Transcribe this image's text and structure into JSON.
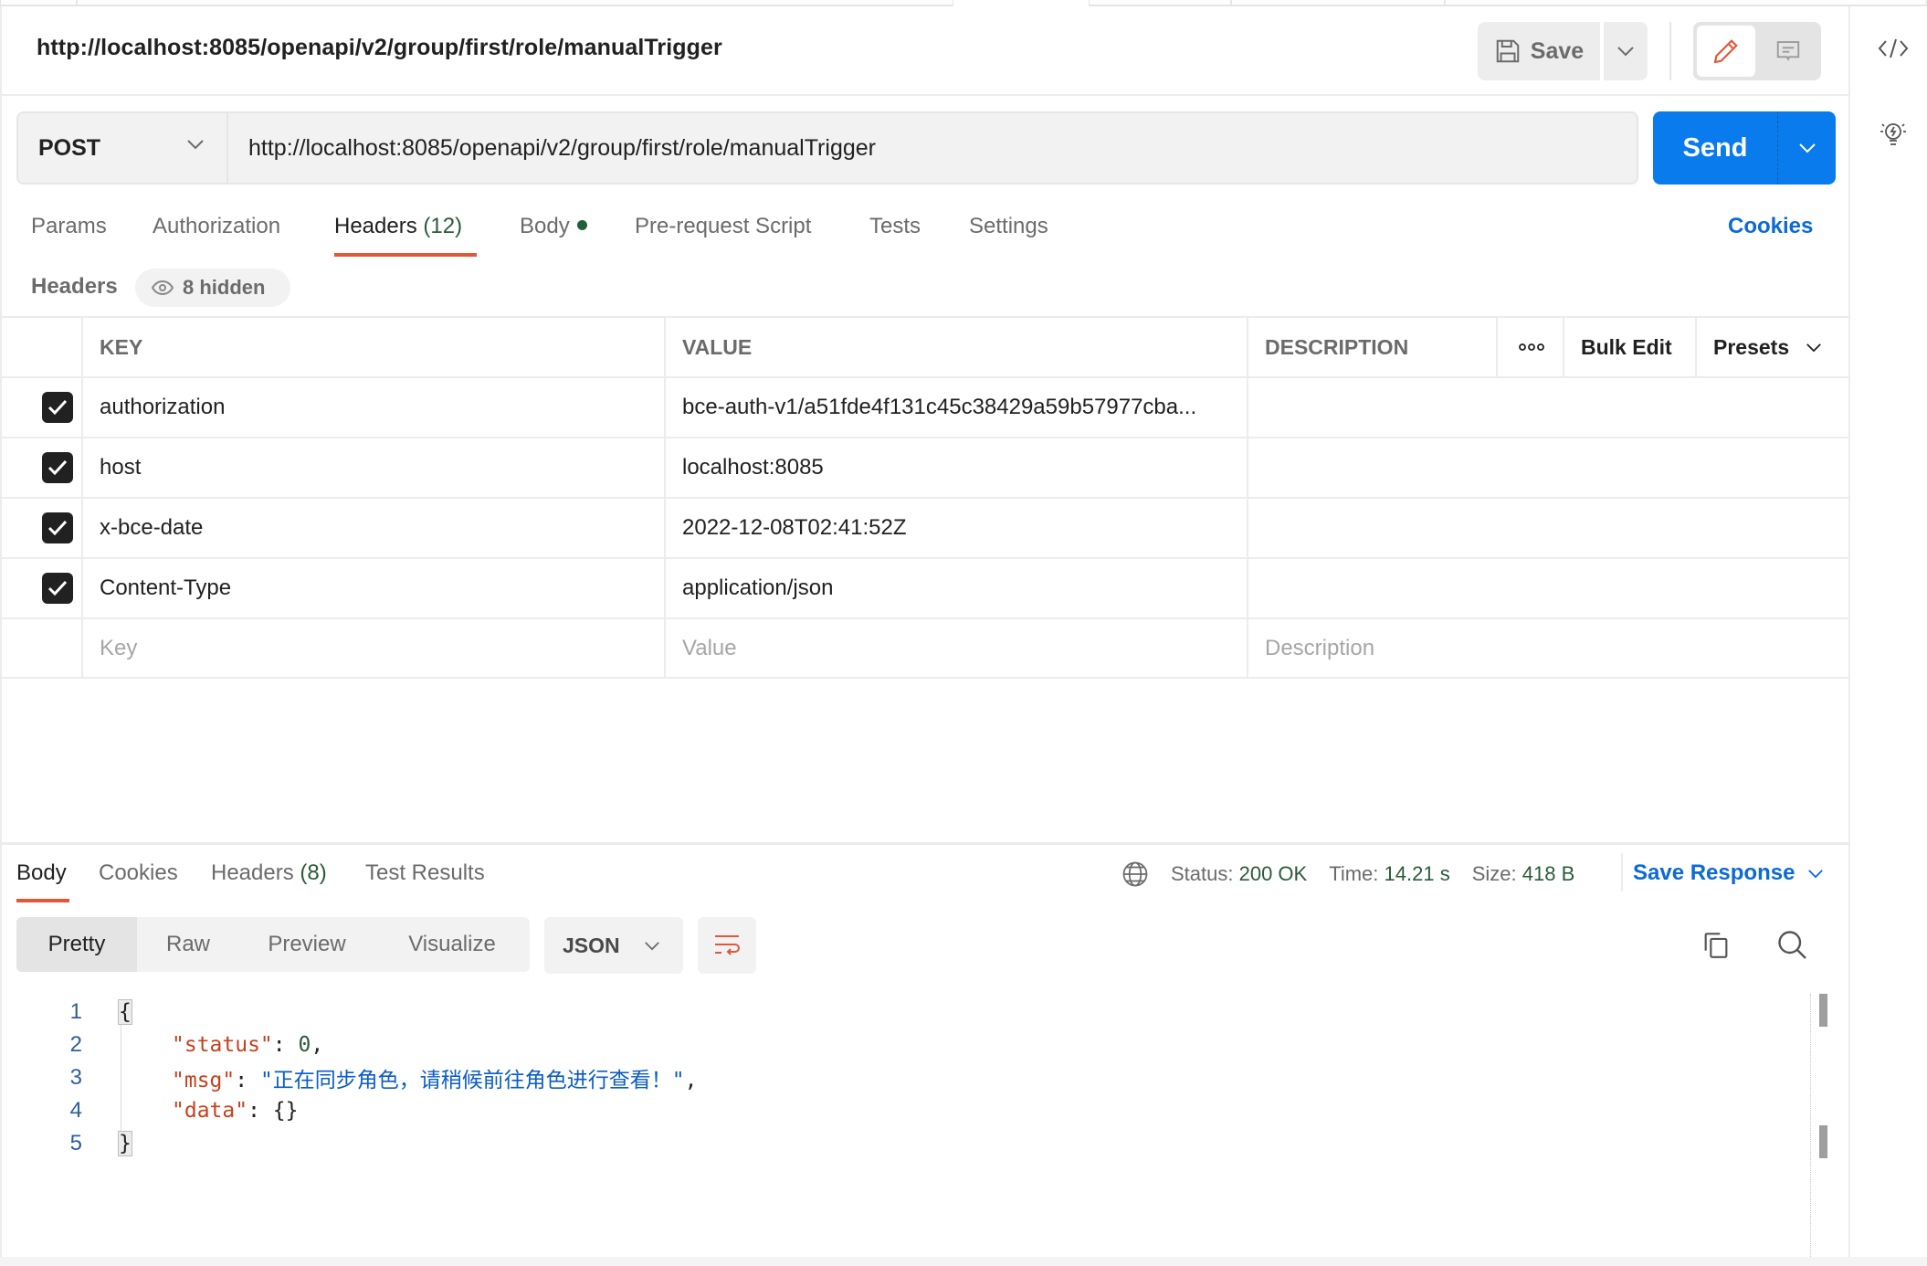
{
  "request": {
    "title": "http://localhost:8085/openapi/v2/group/first/role/manualTrigger",
    "method": "POST",
    "url": "http://localhost:8085/openapi/v2/group/first/role/manualTrigger"
  },
  "toolbar": {
    "save_label": "Save",
    "send_label": "Send",
    "save_icon": "floppy-disk-icon",
    "edit_icon": "pencil-icon",
    "comment_icon": "comment-icon"
  },
  "right_sidebar": {
    "items": [
      {
        "icon": "code-icon"
      },
      {
        "icon": "lightbulb-icon"
      }
    ]
  },
  "request_tabs": {
    "items": [
      {
        "label": "Params"
      },
      {
        "label": "Authorization"
      },
      {
        "label": "Headers",
        "count": "(12)",
        "active": true
      },
      {
        "label": "Body",
        "dot": true
      },
      {
        "label": "Pre-request Script"
      },
      {
        "label": "Tests"
      },
      {
        "label": "Settings"
      }
    ],
    "cookies_label": "Cookies"
  },
  "headers_section": {
    "label": "Headers",
    "hidden_label": "8 hidden",
    "columns": {
      "key": "KEY",
      "value": "VALUE",
      "description": "DESCRIPTION",
      "more": "ooo",
      "bulk_edit": "Bulk Edit",
      "presets": "Presets"
    },
    "rows": [
      {
        "checked": true,
        "key": "authorization",
        "value": "bce-auth-v1/a51fde4f131c45c38429a59b57977cba...",
        "description": ""
      },
      {
        "checked": true,
        "key": "host",
        "value": "localhost:8085",
        "description": ""
      },
      {
        "checked": true,
        "key": "x-bce-date",
        "value": "2022-12-08T02:41:52Z",
        "description": ""
      },
      {
        "checked": true,
        "key": "Content-Type",
        "value": "application/json",
        "description": ""
      }
    ],
    "placeholders": {
      "key": "Key",
      "value": "Value",
      "description": "Description"
    }
  },
  "response": {
    "tabs": [
      {
        "label": "Body",
        "active": true
      },
      {
        "label": "Cookies"
      },
      {
        "label": "Headers",
        "count": "(8)"
      },
      {
        "label": "Test Results"
      }
    ],
    "status_label": "Status:",
    "status_value": "200 OK",
    "time_label": "Time:",
    "time_value": "14.21 s",
    "size_label": "Size:",
    "size_value": "418 B",
    "save_response_label": "Save Response",
    "view_options": [
      "Pretty",
      "Raw",
      "Preview",
      "Visualize"
    ],
    "active_view": "Pretty",
    "format": "JSON",
    "code_lines": [
      {
        "n": "1"
      },
      {
        "n": "2",
        "key": "\"status\"",
        "value": "0"
      },
      {
        "n": "3",
        "key": "\"msg\"",
        "value": "\"正在同步角色，请稍候前往角色进行查看！\""
      },
      {
        "n": "4",
        "key": "\"data\"",
        "value": "{}"
      },
      {
        "n": "5"
      }
    ],
    "open_brace": "{",
    "close_brace": "}"
  },
  "colors": {
    "accent": "#e0583a",
    "send_blue": "#097bed",
    "link_blue": "#0b6ad6",
    "json_key": "#c8401e",
    "json_string": "#0b5cc4"
  }
}
